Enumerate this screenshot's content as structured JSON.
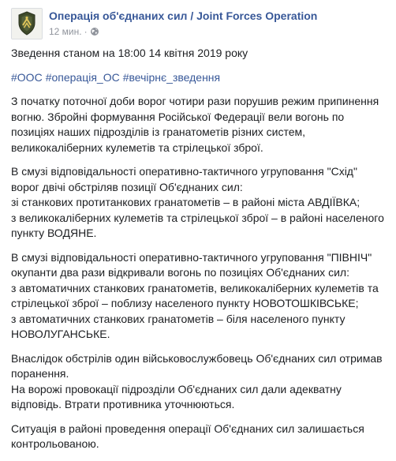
{
  "post": {
    "page_name": "Операція об'єднаних сил / Joint Forces Operation",
    "time": "12 мин.",
    "separator": "·",
    "audience_icon": "globe-icon",
    "title": "Зведення станом на 18:00 14 квітня 2019 року",
    "hashtags": [
      "#ООС",
      "#операція_ОС",
      "#вечірнє_зведення"
    ],
    "paragraphs": [
      [
        "З початку поточної доби ворог чотири рази порушив режим припинення",
        "вогню. Збройні формування Російської Федерації вели вогонь по",
        "позиціях наших підрозділів із гранатометів різних систем,",
        "великокаліберних кулеметів та стрілецької зброї."
      ],
      [
        "В смузі відповідальності оперативно-тактичного угруповання \"Схід\"",
        "ворог двічі обстріляв позиції Об'єднаних сил:",
        "зі станкових протитанкових гранатометів – в районі міста АВДІЇВКА;",
        "з великокаліберних кулеметів та стрілецької зброї – в районі населеного",
        "пункту ВОДЯНЕ."
      ],
      [
        "В смузі відповідальності оперативно-тактичного угруповання \"ПІВНІЧ\"",
        "окупанти два рази відкривали вогонь по позиціях Об'єднаних сил:",
        "з автоматичних станкових гранатометів, великокаліберних кулеметів та",
        "стрілецької зброї – поблизу населеного пункту НОВОТОШКІВСЬКЕ;",
        "з автоматичних станкових гранатометів – біля населеного пункту",
        "НОВОЛУГАНСЬКЕ."
      ],
      [
        "Внаслідок обстрілів один військовослужбовець Об'єднаних сил отримав",
        "поранення.",
        "На ворожі провокації підрозділи Об'єднаних сил дали адекватну",
        "відповідь. Втрати противника уточнюються."
      ],
      [
        "Ситуація в районі проведення операції Об'єднаних сил залишається",
        "контрольованою."
      ]
    ]
  },
  "colors": {
    "link": "#385898",
    "text": "#1c1e21",
    "meta": "#90949c"
  }
}
